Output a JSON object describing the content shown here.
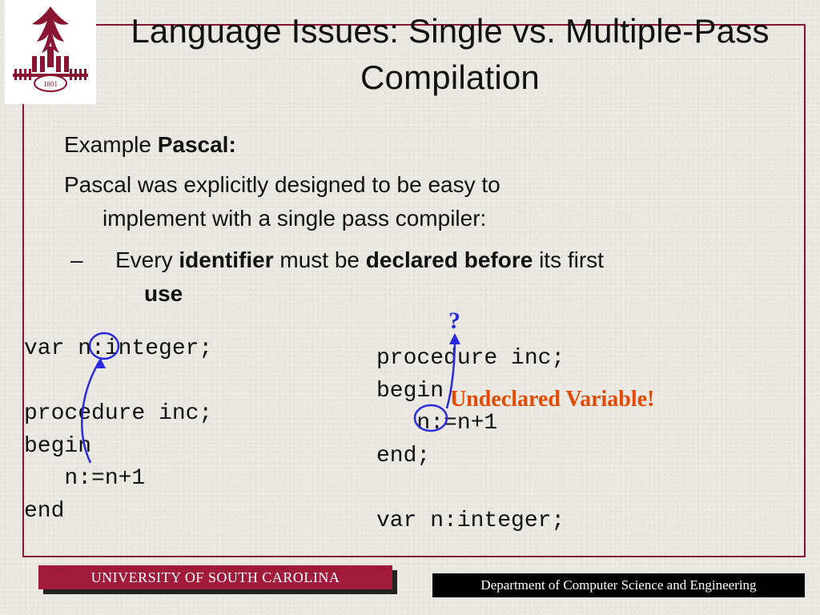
{
  "title": "Language Issues: Single vs. Multiple-Pass Compilation",
  "p1_prefix": "Example ",
  "p1_bold": "Pascal:",
  "p2_line1": "Pascal was explicitly designed to be easy to",
  "p2_line2": "implement with a single pass compiler:",
  "bullet_dash": "– ",
  "bullet_t1": "Every ",
  "bullet_b1": "identifier",
  "bullet_t2": " must be ",
  "bullet_b2": "declared before",
  "bullet_t3": " its first",
  "bullet_b3": "use",
  "code_left": "var n:integer;\n\nprocedure inc;\nbegin\n   n:=n+1\nend",
  "code_right": "procedure inc;\nbegin\n   n:=n+1\nend;\n\nvar n:integer;",
  "question_mark": "?",
  "undeclared": "Undeclared Variable!",
  "footer_univ": "UNIVERSITY OF SOUTH CAROLINA",
  "footer_dept": "Department of Computer Science and Engineering",
  "colors": {
    "maroon": "#8a1532",
    "maroon_bar": "#a01b3a",
    "annotation_blue": "#2a2ae0",
    "error_orange": "#e34a00"
  }
}
